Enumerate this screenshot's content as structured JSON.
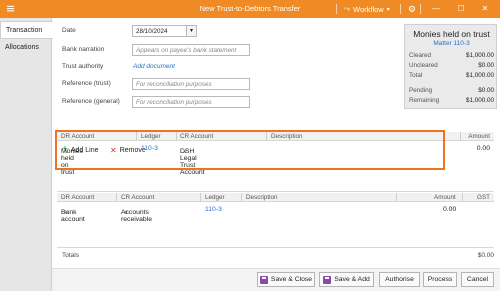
{
  "window": {
    "title": "New Trust-to-Debtors Transfer",
    "workflow_label": "Workflow"
  },
  "tabs": [
    {
      "label": "Transaction",
      "active": true
    },
    {
      "label": "Allocations",
      "active": false
    }
  ],
  "form": {
    "date_label": "Date",
    "date_value": "28/10/2024",
    "bank_narration_label": "Bank narration",
    "bank_narration_placeholder": "Appears on payee's bank statement",
    "trust_authority_label": "Trust authority",
    "add_document_link": "Add document",
    "reference_trust_label": "Reference (trust)",
    "reference_trust_placeholder": "For reconciliation purposes",
    "reference_general_label": "Reference (general)",
    "reference_general_placeholder": "For reconciliation purposes"
  },
  "panel": {
    "title": "Monies held on trust",
    "matter": "Matter 110-3",
    "rows": [
      {
        "label": "Cleared",
        "value": "$1,000.00"
      },
      {
        "label": "Uncleared",
        "value": "$0.00"
      },
      {
        "label": "Total",
        "value": "$1,000.00"
      },
      {
        "label": "Pending",
        "value": "$0.00"
      },
      {
        "label": "Remaining",
        "value": "$1,000.00"
      }
    ]
  },
  "toolbar": {
    "add_line": "Add Line",
    "remove": "Remove"
  },
  "trust_grid": {
    "headers": {
      "dr": "DR Account",
      "ledger": "Ledger",
      "cr": "CR Account",
      "description": "Description",
      "amount": "Amount"
    },
    "row": {
      "dr": "Monies held on trust",
      "ledger": "110-3",
      "cr": "DSH Legal Trust Account",
      "amount": "0.00"
    }
  },
  "general_grid": {
    "headers": {
      "dr": "DR Account",
      "cr": "CR Account",
      "ledger": "Ledger",
      "description": "Description",
      "amount": "Amount",
      "gst": "GST"
    },
    "row": {
      "dr": "Bank account",
      "cr": "Accounts receivable",
      "ledger": "110-3",
      "amount": "0.00"
    }
  },
  "totals": {
    "label": "Totals",
    "value": "$0.00"
  },
  "buttons": {
    "save_close": "Save & Close",
    "save_add": "Save & Add",
    "authorise": "Authorise",
    "process": "Process",
    "cancel": "Cancel"
  },
  "colors": {
    "titlebar": "#f08a24",
    "highlight": "#f07320",
    "link": "#2a6fc9"
  }
}
